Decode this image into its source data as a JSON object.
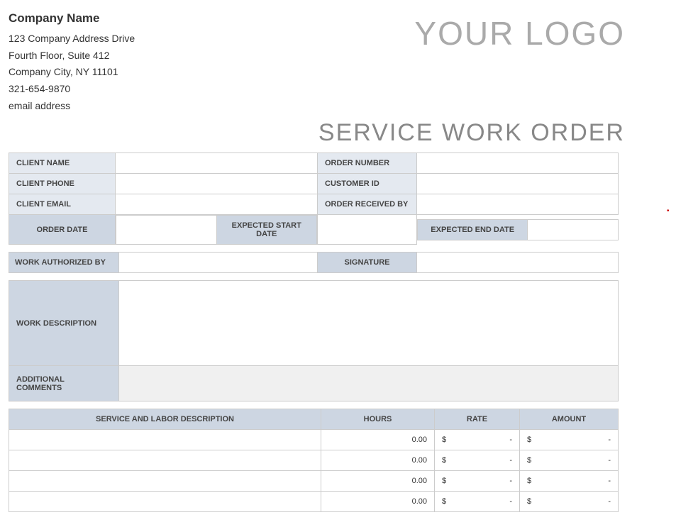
{
  "company": {
    "name": "Company Name",
    "address1": "123 Company Address Drive",
    "address2": "Fourth Floor, Suite 412",
    "city_line": "Company City, NY  11101",
    "phone": "321-654-9870",
    "email": "email address"
  },
  "logo_text": "YOUR LOGO",
  "doc_title": "SERVICE WORK ORDER",
  "labels": {
    "client_name": "CLIENT NAME",
    "client_phone": "CLIENT PHONE",
    "client_email": "CLIENT EMAIL",
    "order_number": "ORDER NUMBER",
    "customer_id": "CUSTOMER ID",
    "order_received_by": "ORDER RECEIVED BY",
    "order_date": "ORDER DATE",
    "expected_start": "EXPECTED START DATE",
    "expected_end": "EXPECTED END DATE",
    "work_authorized_by": "WORK AUTHORIZED BY",
    "signature": "SIGNATURE",
    "work_description": "WORK DESCRIPTION",
    "additional_comments": "ADDITIONAL COMMENTS",
    "service_desc": "SERVICE AND LABOR DESCRIPTION",
    "hours": "HOURS",
    "rate": "RATE",
    "amount": "AMOUNT"
  },
  "client": {
    "name": "",
    "phone": "",
    "email": "",
    "order_number": "",
    "customer_id": "",
    "order_received_by": "",
    "order_date": "",
    "expected_start": "",
    "expected_end": "",
    "authorized_by": "",
    "signature": "",
    "work_description": "",
    "additional_comments": ""
  },
  "currency": "$",
  "dash": "-",
  "line_items": [
    {
      "desc": "",
      "hours": "0.00",
      "rate": "-",
      "amount": "-"
    },
    {
      "desc": "",
      "hours": "0.00",
      "rate": "-",
      "amount": "-"
    },
    {
      "desc": "",
      "hours": "0.00",
      "rate": "-",
      "amount": "-"
    },
    {
      "desc": "",
      "hours": "0.00",
      "rate": "-",
      "amount": "-"
    }
  ]
}
